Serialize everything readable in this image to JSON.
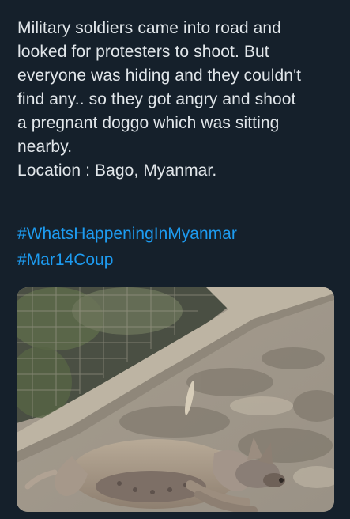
{
  "tweet": {
    "lines": [
      "Military soldiers came into road and",
      "looked for protesters to shoot. But",
      "everyone was hiding and they couldn't",
      "find any.. so they got angry and shoot",
      "a pregnant doggo which was sitting",
      "nearby.",
      "Location : Bago, Myanmar."
    ],
    "hashtags": [
      "#WhatsHappeningInMyanmar",
      "#Mar14Coup"
    ]
  },
  "colors": {
    "background": "#15202b",
    "text": "#e1e6ea",
    "link": "#1d9bf0"
  }
}
